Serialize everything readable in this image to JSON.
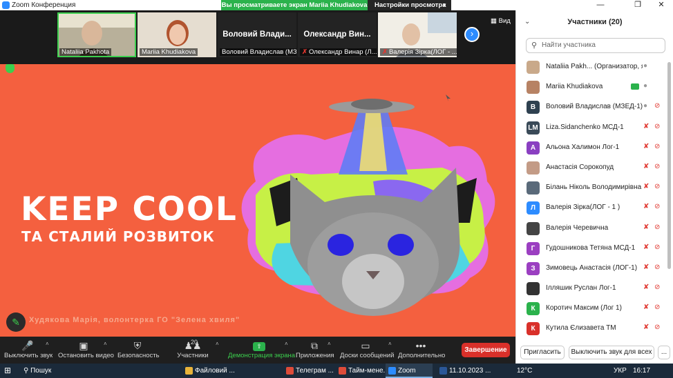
{
  "window": {
    "title": "Zoom Конференция",
    "share_banner": "Вы просматриваете экран Mariia Khudiakova",
    "view_settings": "Настройки просмотра",
    "view_button": "Вид"
  },
  "strip": {
    "tiles": [
      {
        "label": "Nataliia Pakhota",
        "big": "",
        "muted": false
      },
      {
        "label": "Mariia Khudiakova",
        "big": "",
        "muted": false
      },
      {
        "label": "Воловий Владислав (МЗЕ...",
        "big": "Воловий Влади...",
        "muted": false
      },
      {
        "label": "Олександр Винар (Л...",
        "big": "Олександр Вин...",
        "muted": true
      },
      {
        "label": "Валерія Зірка(ЛОГ - ...",
        "big": "",
        "muted": true
      }
    ]
  },
  "slide": {
    "headline": "KEEP COOL",
    "subline": "ТА СТАЛИЙ РОЗВИТОК",
    "caption": "Худякова Марія, волонтерка ГО \"Зелена хвиля\""
  },
  "panel": {
    "title": "Участники (20)",
    "search_placeholder": "Найти участника",
    "participants": [
      {
        "name": "Nataliia Pakh... (Организатор, я)",
        "avatar_text": "",
        "avatar_color": "#c9a98a",
        "mic_off": false,
        "cam_off": false,
        "sharing": false
      },
      {
        "name": "Mariia Khudiakova",
        "avatar_text": "",
        "avatar_color": "#b78264",
        "mic_off": false,
        "cam_off": false,
        "sharing": true
      },
      {
        "name": "Воловий Владислав (МЗЕД-1)",
        "avatar_text": "В",
        "avatar_color": "#2f4150",
        "mic_off": false,
        "cam_off": true,
        "sharing": false
      },
      {
        "name": "Liza.Sidanchenko МСД-1",
        "avatar_text": "LM",
        "avatar_color": "#3a4a58",
        "mic_off": true,
        "cam_off": true,
        "sharing": false
      },
      {
        "name": "Альона Халимон Лог-1",
        "avatar_text": "А",
        "avatar_color": "#8a3fc1",
        "mic_off": true,
        "cam_off": true,
        "sharing": false
      },
      {
        "name": "Анастасія Сорокопуд",
        "avatar_text": "",
        "avatar_color": "#c39b86",
        "mic_off": true,
        "cam_off": true,
        "sharing": false
      },
      {
        "name": "Білань Ніколь Володимирівна ...",
        "avatar_text": "",
        "avatar_color": "#5a6a7a",
        "mic_off": true,
        "cam_off": true,
        "sharing": false
      },
      {
        "name": "Валерія Зірка(ЛОГ - 1 )",
        "avatar_text": "Л",
        "avatar_color": "#2d8cff",
        "mic_off": true,
        "cam_off": true,
        "sharing": false
      },
      {
        "name": "Валерія Черевична",
        "avatar_text": "",
        "avatar_color": "#444",
        "mic_off": true,
        "cam_off": true,
        "sharing": false
      },
      {
        "name": "Гудошникова Тетяна МСД-1",
        "avatar_text": "Г",
        "avatar_color": "#9b3fc1",
        "mic_off": true,
        "cam_off": true,
        "sharing": false
      },
      {
        "name": "Зимовець Анастасія (ЛОГ-1)",
        "avatar_text": "З",
        "avatar_color": "#9b3fc1",
        "mic_off": true,
        "cam_off": true,
        "sharing": false
      },
      {
        "name": "Ілляшик Руслан Лог-1",
        "avatar_text": "",
        "avatar_color": "#333",
        "mic_off": true,
        "cam_off": true,
        "sharing": false
      },
      {
        "name": "Коротич Максим (Лог 1)",
        "avatar_text": "К",
        "avatar_color": "#2bb24c",
        "mic_off": true,
        "cam_off": true,
        "sharing": false
      },
      {
        "name": "Кутила Єлизавета ТМ",
        "avatar_text": "К",
        "avatar_color": "#d9302a",
        "mic_off": true,
        "cam_off": true,
        "sharing": false
      }
    ],
    "invite": "Пригласить",
    "mute_all": "Выключить звук для всех",
    "more": "..."
  },
  "toolbar": {
    "mute": "Выключить звук",
    "video": "Остановить видео",
    "security": "Безопасность",
    "participants": "Участники",
    "participants_count": "20",
    "share": "Демонстрация экрана",
    "apps": "Приложения",
    "whiteboard": "Доски сообщений",
    "more": "Дополнительно",
    "end": "Завершение"
  },
  "taskbar": {
    "search": "Пошук",
    "apps": [
      {
        "label": "Файловий ...",
        "color": "#e8b33a",
        "active": false
      },
      {
        "label": "Телеграм ...",
        "color": "#dd4b39",
        "active": false
      },
      {
        "label": "Тайм-мене...",
        "color": "#dd4b39",
        "active": false
      },
      {
        "label": "Zoom",
        "color": "#2d8cff",
        "active": true
      },
      {
        "label": "11.10.2023 ...",
        "color": "#2b5797",
        "active": false
      }
    ],
    "temperature": "12°C",
    "language": "УКР",
    "time": "16:17"
  }
}
